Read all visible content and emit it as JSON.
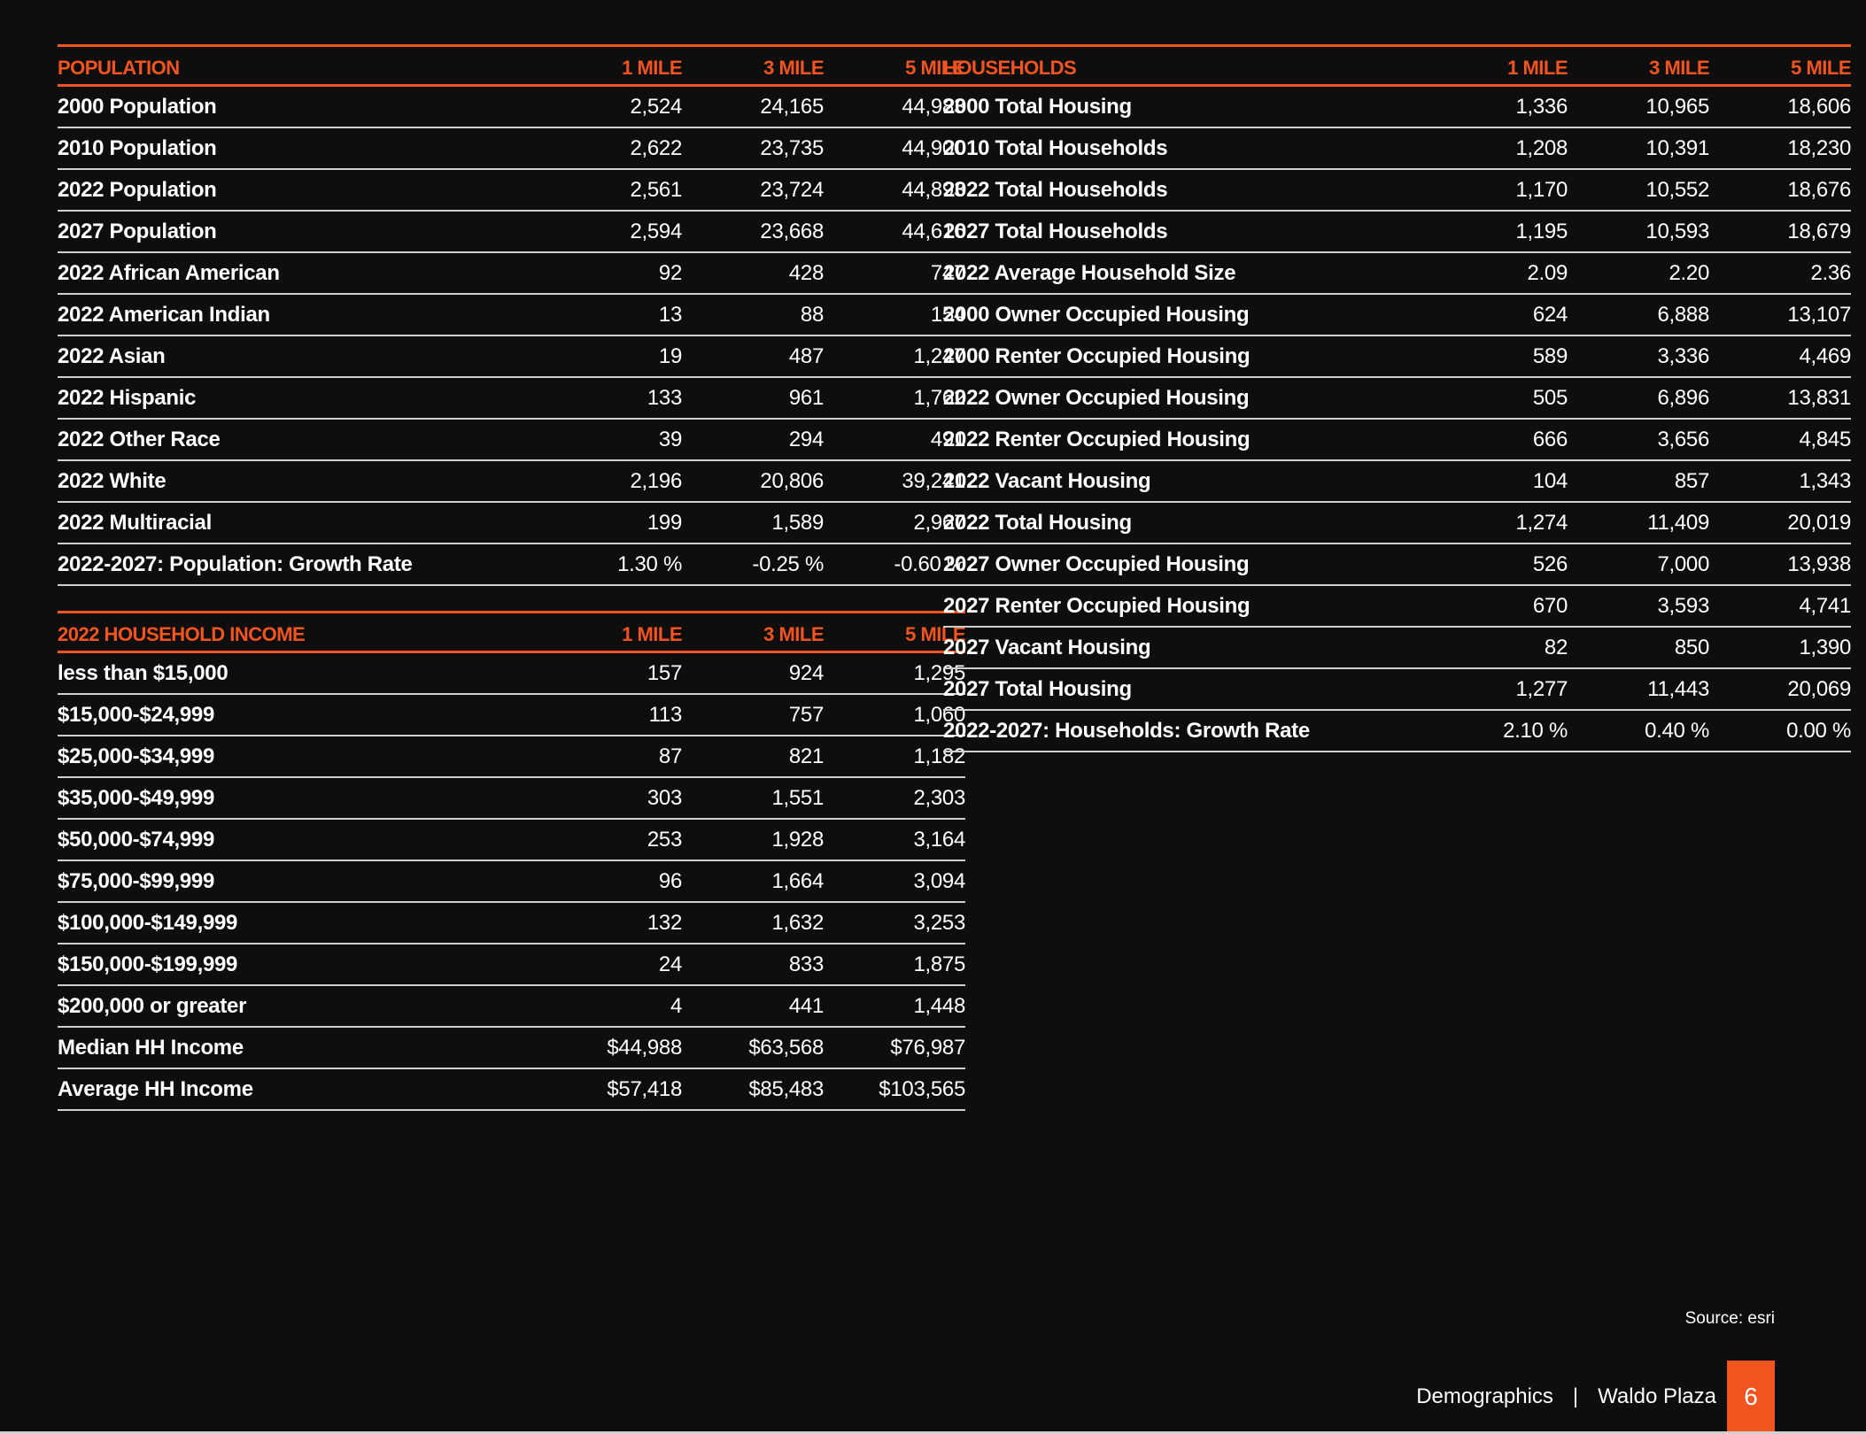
{
  "population": {
    "header": [
      "POPULATION",
      "1 MILE",
      "3 MILE",
      "5 MILE"
    ],
    "rows": [
      [
        "2000 Population",
        "2,524",
        "24,165",
        "44,983"
      ],
      [
        "2010 Population",
        "2,622",
        "23,735",
        "44,900"
      ],
      [
        "2022 Population",
        "2,561",
        "23,724",
        "44,893"
      ],
      [
        "2027 Population",
        "2,594",
        "23,668",
        "44,616"
      ],
      [
        "2022 African American",
        "92",
        "428",
        "747"
      ],
      [
        "2022 American Indian",
        "13",
        "88",
        "154"
      ],
      [
        "2022 Asian",
        "19",
        "487",
        "1,247"
      ],
      [
        "2022 Hispanic",
        "133",
        "961",
        "1,762"
      ],
      [
        "2022 Other Race",
        "39",
        "294",
        "491"
      ],
      [
        "2022 White",
        "2,196",
        "20,806",
        "39,241"
      ],
      [
        "2022 Multiracial",
        "199",
        "1,589",
        "2,967"
      ],
      [
        "2022-2027: Population: Growth Rate",
        "1.30 %",
        "-0.25 %",
        "-0.60 %"
      ]
    ]
  },
  "income": {
    "header": [
      "2022 HOUSEHOLD INCOME",
      "1 MILE",
      "3 MILE",
      "5 MILE"
    ],
    "rows": [
      [
        "less than $15,000",
        "157",
        "924",
        "1,295"
      ],
      [
        "$15,000-$24,999",
        "113",
        "757",
        "1,060"
      ],
      [
        "$25,000-$34,999",
        "87",
        "821",
        "1,182"
      ],
      [
        "$35,000-$49,999",
        "303",
        "1,551",
        "2,303"
      ],
      [
        "$50,000-$74,999",
        "253",
        "1,928",
        "3,164"
      ],
      [
        "$75,000-$99,999",
        "96",
        "1,664",
        "3,094"
      ],
      [
        "$100,000-$149,999",
        "132",
        "1,632",
        "3,253"
      ],
      [
        "$150,000-$199,999",
        "24",
        "833",
        "1,875"
      ],
      [
        "$200,000 or greater",
        "4",
        "441",
        "1,448"
      ],
      [
        "Median HH Income",
        "$44,988",
        "$63,568",
        "$76,987"
      ],
      [
        "Average HH Income",
        "$57,418",
        "$85,483",
        "$103,565"
      ]
    ]
  },
  "households": {
    "header": [
      "HOUSEHOLDS",
      "1 MILE",
      "3 MILE",
      "5 MILE"
    ],
    "rows": [
      [
        "2000 Total Housing",
        "1,336",
        "10,965",
        "18,606"
      ],
      [
        "2010 Total Households",
        "1,208",
        "10,391",
        "18,230"
      ],
      [
        "2022 Total Households",
        "1,170",
        "10,552",
        "18,676"
      ],
      [
        "2027 Total Households",
        "1,195",
        "10,593",
        "18,679"
      ],
      [
        "2022 Average Household Size",
        "2.09",
        "2.20",
        "2.36"
      ],
      [
        "2000 Owner Occupied Housing",
        "624",
        "6,888",
        "13,107"
      ],
      [
        "2000 Renter Occupied Housing",
        "589",
        "3,336",
        "4,469"
      ],
      [
        "2022 Owner Occupied Housing",
        "505",
        "6,896",
        "13,831"
      ],
      [
        "2022 Renter Occupied Housing",
        "666",
        "3,656",
        "4,845"
      ],
      [
        "2022 Vacant Housing",
        "104",
        "857",
        "1,343"
      ],
      [
        "2022 Total Housing",
        "1,274",
        "11,409",
        "20,019"
      ],
      [
        "2027 Owner Occupied Housing",
        "526",
        "7,000",
        "13,938"
      ],
      [
        "2027 Renter Occupied Housing",
        "670",
        "3,593",
        "4,741"
      ],
      [
        "2027 Vacant Housing",
        "82",
        "850",
        "1,390"
      ],
      [
        "2027 Total Housing",
        "1,277",
        "11,443",
        "20,069"
      ],
      [
        "2022-2027: Households: Growth Rate",
        "2.10 %",
        "0.40 %",
        "0.00 %"
      ]
    ]
  },
  "source": "Source: esri",
  "footer": {
    "section": "Demographics",
    "separator": "|",
    "property": "Waldo Plaza",
    "page_number": "6"
  },
  "colors": {
    "accent": "#f1541f",
    "background": "#0e0e0e",
    "text": "#ffffff",
    "rule": "#cfcfcf"
  }
}
